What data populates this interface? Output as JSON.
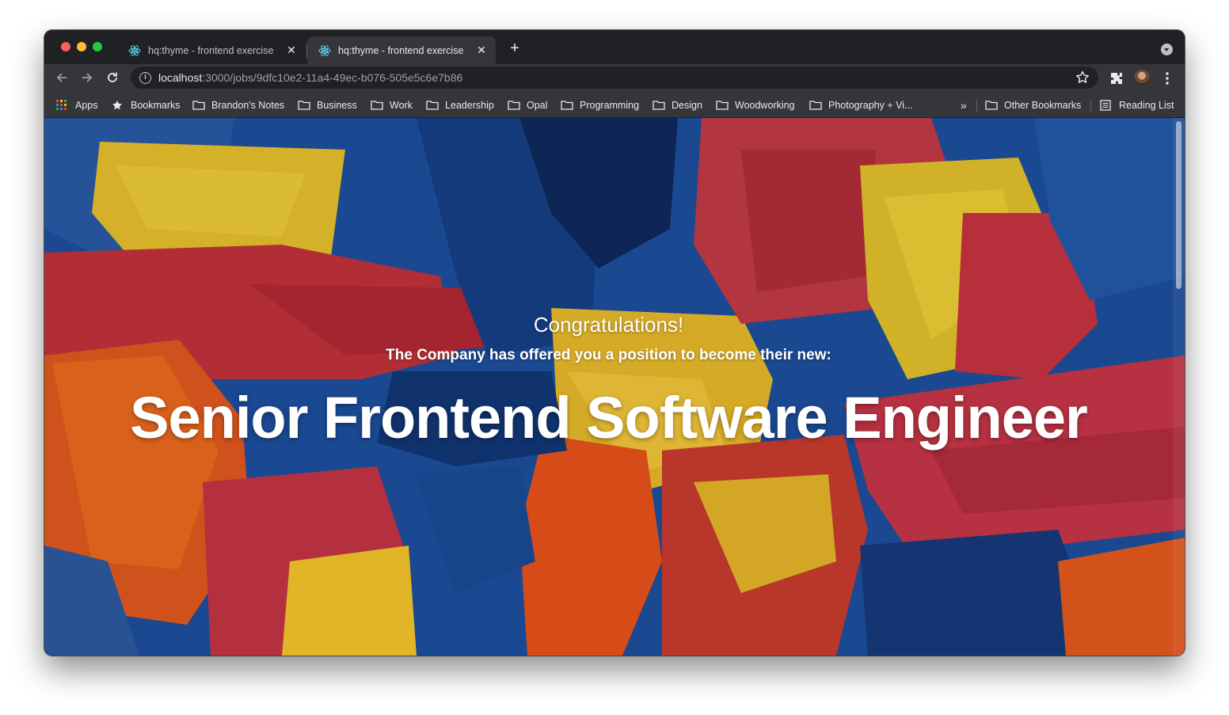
{
  "browser": {
    "tabs": [
      {
        "title": "hq:thyme - frontend exercise",
        "active": false
      },
      {
        "title": "hq:thyme - frontend exercise",
        "active": true
      }
    ],
    "url": {
      "host": "localhost",
      "path": ":3000/jobs/9dfc10e2-11a4-49ec-b076-505e5c6e7b86"
    },
    "bookmarks": [
      {
        "label": "Apps",
        "icon": "apps-grid-icon"
      },
      {
        "label": "Bookmarks",
        "icon": "star-icon"
      },
      {
        "label": "Brandon's Notes",
        "icon": "folder-icon"
      },
      {
        "label": "Business",
        "icon": "folder-icon"
      },
      {
        "label": "Work",
        "icon": "folder-icon"
      },
      {
        "label": "Leadership",
        "icon": "folder-icon"
      },
      {
        "label": "Opal",
        "icon": "folder-icon"
      },
      {
        "label": "Programming",
        "icon": "folder-icon"
      },
      {
        "label": "Design",
        "icon": "folder-icon"
      },
      {
        "label": "Woodworking",
        "icon": "folder-icon"
      },
      {
        "label": "Photography + Vi...",
        "icon": "folder-icon"
      }
    ],
    "overflow_label": "»",
    "other_bookmarks": "Other Bookmarks",
    "reading_list": "Reading List"
  },
  "page": {
    "congrats": "Congratulations!",
    "offer": "The Company has offered you a position to become their new:",
    "job_title": "Senior Frontend Software Engineer"
  },
  "colors": {
    "chrome_dark": "#202124",
    "chrome_toolbar": "#35363a",
    "text_light": "#e8eaed"
  }
}
